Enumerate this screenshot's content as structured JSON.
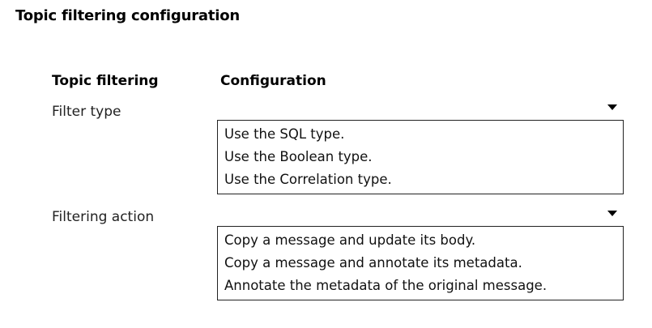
{
  "page": {
    "title": "Topic filtering configuration"
  },
  "headers": {
    "left": "Topic filtering",
    "right": "Configuration"
  },
  "rows": [
    {
      "label": "Filter type",
      "selected": "",
      "options": [
        "Use the SQL type.",
        "Use the Boolean type.",
        "Use the Correlation type."
      ]
    },
    {
      "label": "Filtering action",
      "selected": "",
      "options": [
        "Copy a message and update its body.",
        "Copy a message and annotate its metadata.",
        "Annotate the metadata of the original message."
      ]
    }
  ],
  "icons": {
    "dropdown": "chevron-down-icon"
  }
}
